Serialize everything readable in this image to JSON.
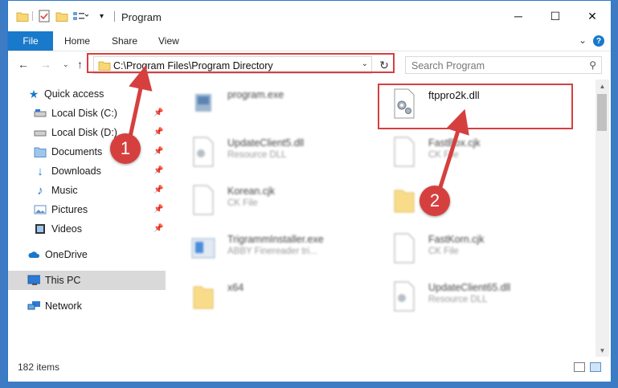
{
  "window": {
    "title": "Program",
    "controls": {
      "minimize": "─",
      "maximize": "☐",
      "close": "✕"
    }
  },
  "ribbon": {
    "tabs": [
      "File",
      "Home",
      "Share",
      "View"
    ],
    "expand_icon": "chevron-down-icon",
    "help_label": "?"
  },
  "nav": {
    "address": "C:\\Program Files\\Program Directory",
    "search_placeholder": "Search Program"
  },
  "sidebar": {
    "items": [
      {
        "label": "Quick access",
        "icon": "star-icon",
        "pinned": false
      },
      {
        "label": "Local Disk (C:)",
        "icon": "drive-icon",
        "pinned": true
      },
      {
        "label": "Local Disk (D:)",
        "icon": "drive-icon",
        "pinned": true
      },
      {
        "label": "Documents",
        "icon": "documents-icon",
        "pinned": true
      },
      {
        "label": "Downloads",
        "icon": "download-icon",
        "pinned": true
      },
      {
        "label": "Music",
        "icon": "music-icon",
        "pinned": true
      },
      {
        "label": "Pictures",
        "icon": "pictures-icon",
        "pinned": true
      },
      {
        "label": "Videos",
        "icon": "videos-icon",
        "pinned": true
      },
      {
        "label": "OneDrive",
        "icon": "cloud-icon",
        "pinned": false
      },
      {
        "label": "This PC",
        "icon": "monitor-icon",
        "pinned": false,
        "selected": true
      },
      {
        "label": "Network",
        "icon": "network-icon",
        "pinned": false
      }
    ]
  },
  "files": [
    {
      "name": "program.exe",
      "sub": "",
      "icon": "exe-icon",
      "blurred": true
    },
    {
      "name": "ftppro2k.dll",
      "sub": "",
      "icon": "dll-gear-icon",
      "blurred": false
    },
    {
      "name": "UpdateClient5.dll",
      "sub": "Resource DLL",
      "icon": "dll-gear-icon",
      "blurred": true
    },
    {
      "name": "FastBox.cjk",
      "sub": "CK File",
      "icon": "file-icon",
      "blurred": true
    },
    {
      "name": "Korean.cjk",
      "sub": "CK File",
      "icon": "file-icon",
      "blurred": true
    },
    {
      "name": "",
      "sub": "",
      "icon": "folder-icon",
      "blurred": true
    },
    {
      "name": "TrigrammInstaller.exe",
      "sub": "ABBY Finereader tri...",
      "icon": "installer-icon",
      "blurred": true
    },
    {
      "name": "FastKorn.cjk",
      "sub": "CK File",
      "icon": "file-icon",
      "blurred": true
    },
    {
      "name": "x64",
      "sub": "",
      "icon": "folder-icon",
      "blurred": true
    },
    {
      "name": "UpdateClient65.dll",
      "sub": "Resource DLL",
      "icon": "dll-gear-icon",
      "blurred": true
    }
  ],
  "status": {
    "items_count": "182 items"
  },
  "callouts": [
    "1",
    "2"
  ],
  "colors": {
    "accent": "#1979ca",
    "highlight": "#d5403f",
    "desktop": "#3d7bc4"
  }
}
